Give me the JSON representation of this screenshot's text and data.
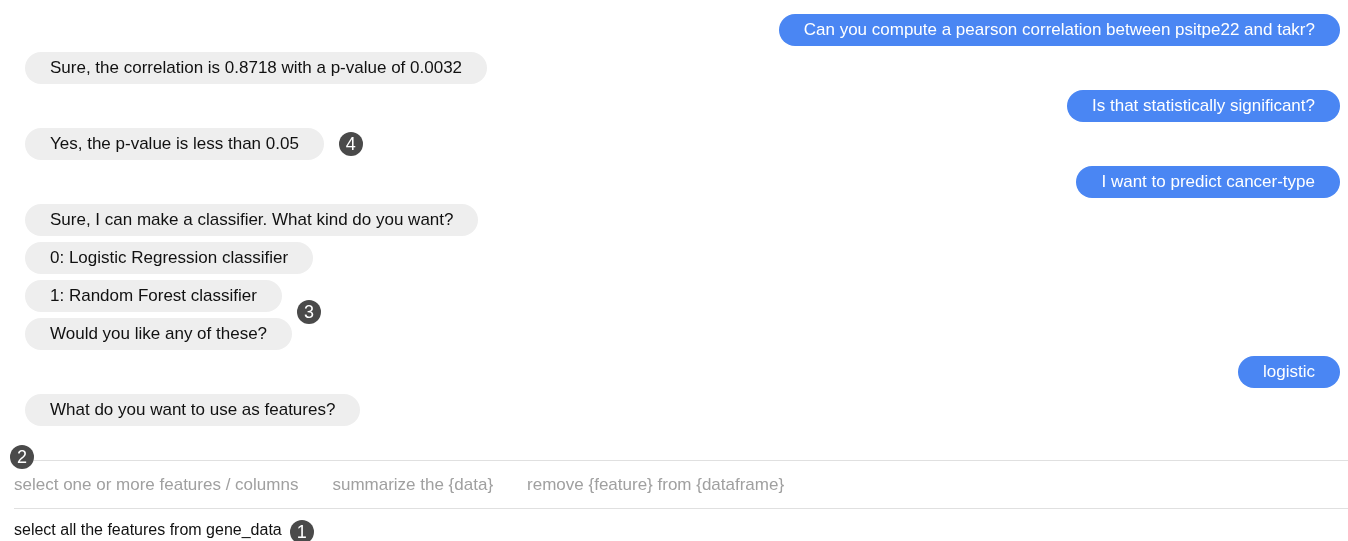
{
  "messages": [
    {
      "kind": "user",
      "text": "Can you compute a pearson correlation between psitpe22 and takr?"
    },
    {
      "kind": "bot",
      "text": "Sure, the correlation is 0.8718 with a p-value of 0.0032"
    },
    {
      "kind": "user",
      "text": "Is that statistically significant?"
    },
    {
      "kind": "bot",
      "text": "Yes, the p-value is less than 0.05",
      "marker": "4"
    },
    {
      "kind": "user",
      "text": "I want to predict cancer-type"
    },
    {
      "kind": "bot",
      "text": "Sure, I can make a classifier. What kind do you want?"
    },
    {
      "kind": "bot",
      "text": "0: Logistic Regression classifier"
    },
    {
      "kind": "bot",
      "text": "1: Random Forest classifier",
      "marker": "3"
    },
    {
      "kind": "bot",
      "text": "Would you like any of these?"
    },
    {
      "kind": "user",
      "text": "logistic"
    },
    {
      "kind": "bot",
      "text": "What do you want to use as features?"
    }
  ],
  "suggestions": {
    "marker": "2",
    "items": [
      "select one or more features / columns",
      "summarize the {data}",
      "remove {feature} from {dataframe}"
    ]
  },
  "input": {
    "value": "select all the features from gene_data",
    "marker": "1"
  }
}
